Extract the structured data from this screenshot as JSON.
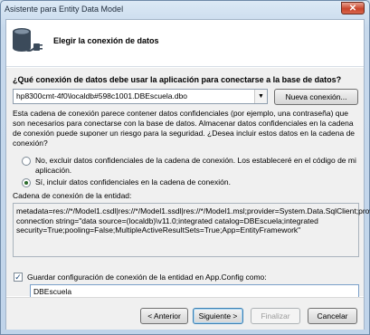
{
  "window": {
    "title": "Asistente para Entity Data Model",
    "close_glyph": "✕"
  },
  "header": {
    "title": "Elegir la conexión de datos",
    "icon": "database-plug-icon"
  },
  "question": "¿Qué conexión de datos debe usar la aplicación para conectarse a la base de datos?",
  "connection": {
    "selected": "hp8300cmt-4f0\\localdb#598c1001.DBEscuela.dbo",
    "new_button": "Nueva conexión..."
  },
  "description": "Esta cadena de conexión parece contener datos confidenciales (por ejemplo, una contraseña) que son necesarios para conectarse con la base de datos. Almacenar datos confidenciales en la cadena de conexión puede suponer un riesgo para la seguridad. ¿Desea incluir estos datos en la cadena de conexión?",
  "options": {
    "exclude": "No, excluir datos confidenciales de la cadena de conexión. Los estableceré en el código de mi aplicación.",
    "include": "Sí, incluir datos confidenciales en la cadena de conexión.",
    "selected": "include"
  },
  "connection_string": {
    "label": "Cadena de conexión de la entidad:",
    "value": "metadata=res://*/Model1.csdl|res://*/Model1.ssdl|res://*/Model1.msl;provider=System.Data.SqlClient;provider connection string=\"data source=(localdb)\\v11.0;integrated catalog=DBEscuela;integrated security=True;pooling=False;MultipleActiveResultSets=True;App=EntityFramework\""
  },
  "save": {
    "label": "Guardar configuración de conexión de la entidad en App.Config como:",
    "checked": true,
    "value": "DBEscuela"
  },
  "buttons": {
    "back": "< Anterior",
    "next": "Siguiente >",
    "finish": "Finalizar",
    "cancel": "Cancelar"
  },
  "colors": {
    "accent": "#3c7fb1",
    "titlebar": "#c7d9ec",
    "close": "#c8442b"
  }
}
